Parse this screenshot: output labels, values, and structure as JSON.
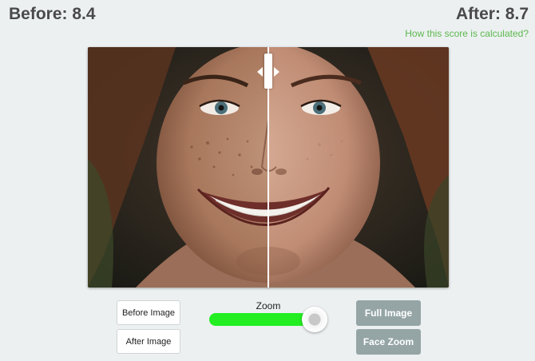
{
  "scores": {
    "before_label": "Before: 8.4",
    "after_label": "After: 8.7",
    "link_text": "How this score is calculated?"
  },
  "controls": {
    "before_button": "Before Image",
    "after_button": "After Image",
    "zoom_label": "Zoom",
    "zoom_level": 0.88,
    "full_image_button": "Full Image",
    "face_zoom_button": "Face Zoom"
  },
  "comparison": {
    "split_position": 0.5
  },
  "colors": {
    "link": "#5db84e",
    "slider_fill": "#22ee22",
    "gray_button": "#95a5a6"
  }
}
